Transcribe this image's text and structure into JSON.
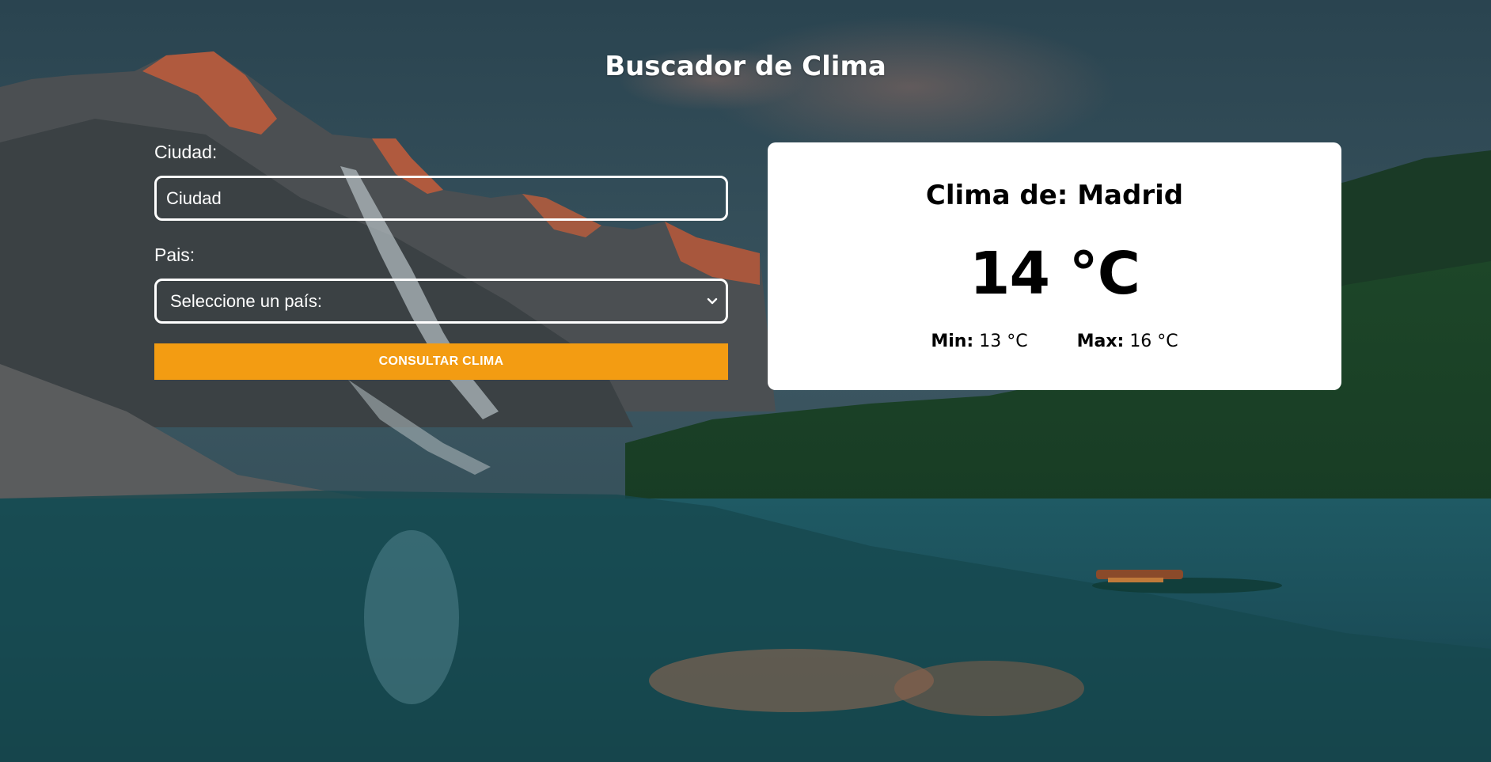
{
  "page": {
    "title": "Buscador de Clima"
  },
  "form": {
    "city_label": "Ciudad:",
    "city_placeholder": "Ciudad",
    "country_label": "Pais:",
    "country_selected": "Seleccione un país:",
    "submit_label": "CONSULTAR CLIMA"
  },
  "weather": {
    "title": "Clima de: Madrid",
    "temp": "14 °C",
    "min_label": "Min:",
    "min_value": "13 °C",
    "max_label": "Max:",
    "max_value": "16 °C"
  },
  "colors": {
    "accent": "#f39c12",
    "card_bg": "#ffffff"
  },
  "icons": {
    "select_arrow": "chevron-down-icon"
  }
}
